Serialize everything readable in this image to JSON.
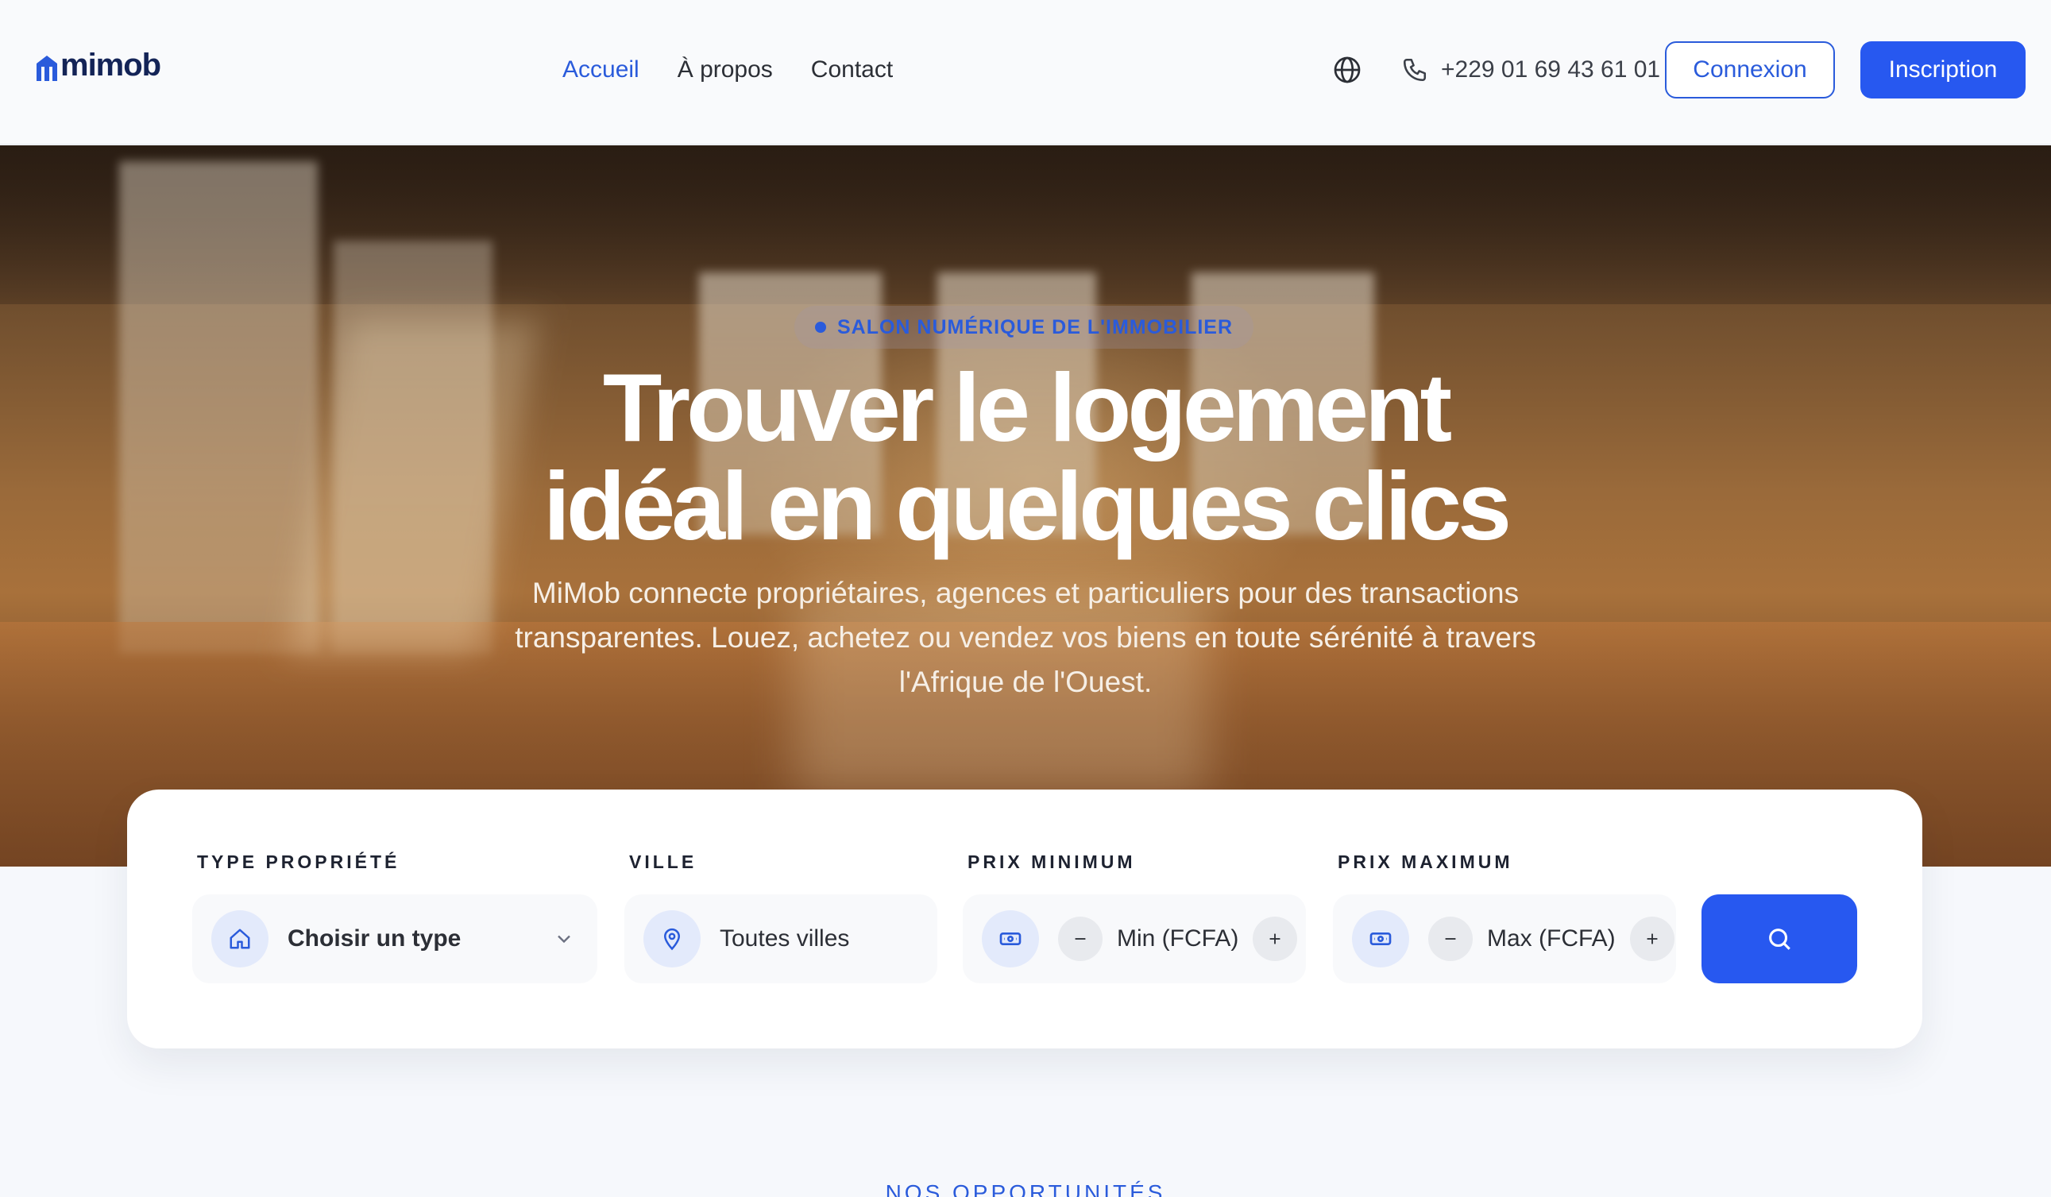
{
  "brand": {
    "name": "mimob",
    "color": "#2a5bdb"
  },
  "nav": {
    "items": [
      {
        "label": "Accueil",
        "active": true
      },
      {
        "label": "À propos",
        "active": false
      },
      {
        "label": "Contact",
        "active": false
      }
    ]
  },
  "header": {
    "language_icon": "globe-icon",
    "phone_icon": "phone-icon",
    "phone": "+229 01 69 43 61 01",
    "login_label": "Connexion",
    "signup_label": "Inscription"
  },
  "hero": {
    "badge": "SALON NUMÉRIQUE DE L'IMMOBILIER",
    "title_line1": "Trouver le logement",
    "title_line2": "idéal en quelques clics",
    "subtitle": "MiMob connecte propriétaires, agences et particuliers pour des transactions transparentes. Louez, achetez ou vendez vos biens en toute sérénité à travers l'Afrique de l'Ouest."
  },
  "search": {
    "type": {
      "label": "TYPE PROPRIÉTÉ",
      "value": "Choisir un type",
      "icon": "home-icon"
    },
    "city": {
      "label": "VILLE",
      "value": "Toutes villes",
      "icon": "map-pin-icon"
    },
    "min_price": {
      "label": "PRIX MINIMUM",
      "placeholder": "Min (FCFA)",
      "icon": "banknote-icon"
    },
    "max_price": {
      "label": "PRIX MAXIMUM",
      "placeholder": "Max (FCFA)",
      "icon": "banknote-icon"
    },
    "submit_icon": "search-icon"
  },
  "section": {
    "label": "NOS OPPORTUNITÉS"
  },
  "colors": {
    "primary": "#2758f0",
    "accent": "#2a5bdb",
    "icon_bg": "#e3eafb"
  }
}
